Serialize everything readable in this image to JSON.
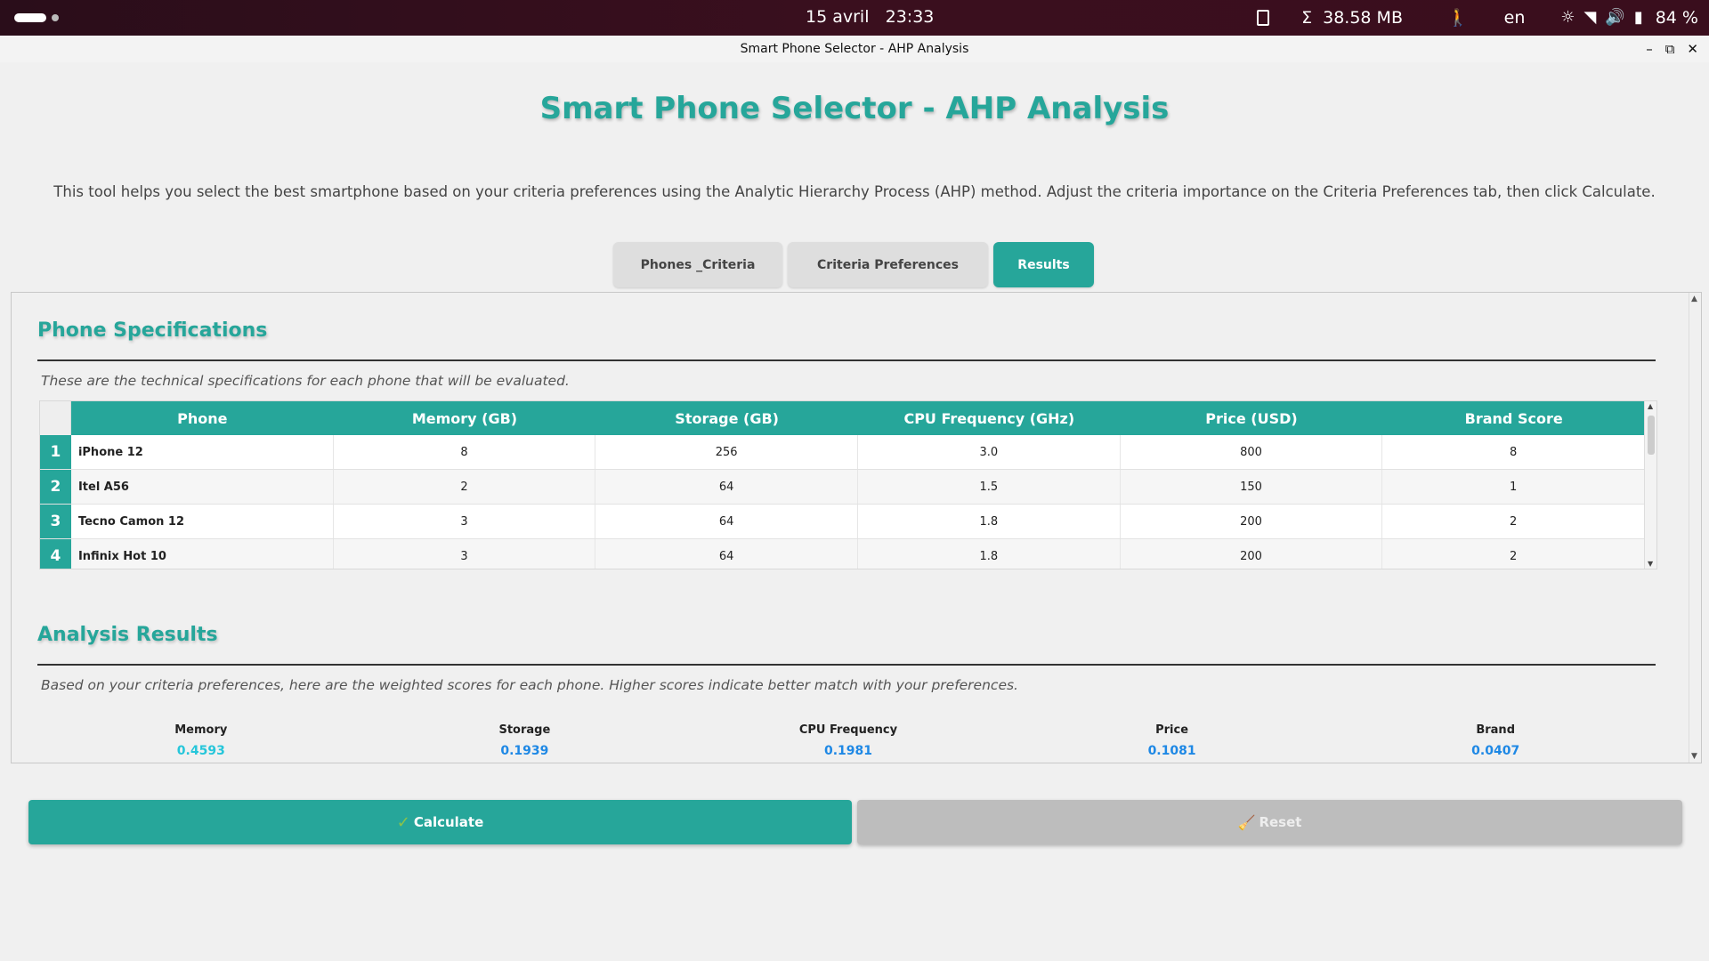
{
  "system_bar": {
    "date": "15 avril",
    "time": "23:33",
    "memory": "38.58 MB",
    "sigma": "Σ",
    "language": "en",
    "battery": "84 %"
  },
  "window": {
    "title": "Smart Phone Selector - AHP Analysis",
    "minimize": "–",
    "maximize": "⧉",
    "close": "✕"
  },
  "header": {
    "title": "Smart Phone Selector - AHP Analysis",
    "intro": "This tool helps you select the best smartphone based on your criteria preferences using the Analytic Hierarchy Process (AHP) method. Adjust the criteria importance on the Criteria Preferences tab, then click Calculate."
  },
  "tabs": [
    {
      "label": "Phones _Criteria",
      "active": false
    },
    {
      "label": "Criteria Preferences",
      "active": false
    },
    {
      "label": "Results",
      "active": true
    }
  ],
  "specs": {
    "title": "Phone Specifications",
    "note": "These are the technical specifications for each phone that will be evaluated.",
    "columns": [
      "Phone",
      "Memory (GB)",
      "Storage (GB)",
      "CPU Frequency (GHz)",
      "Price (USD)",
      "Brand Score"
    ],
    "rows": [
      {
        "num": "1",
        "cells": [
          "iPhone 12",
          "8",
          "256",
          "3.0",
          "800",
          "8"
        ]
      },
      {
        "num": "2",
        "cells": [
          "Itel A56",
          "2",
          "64",
          "1.5",
          "150",
          "1"
        ]
      },
      {
        "num": "3",
        "cells": [
          "Tecno Camon 12",
          "3",
          "64",
          "1.8",
          "200",
          "2"
        ]
      },
      {
        "num": "4",
        "cells": [
          "Infinix Hot 10",
          "3",
          "64",
          "1.8",
          "200",
          "2"
        ]
      }
    ]
  },
  "analysis": {
    "title": "Analysis Results",
    "note": "Based on your criteria preferences, here are the weighted scores for each phone. Higher scores indicate better match with your preferences.",
    "weights": [
      {
        "label": "Memory",
        "value": "0.4593"
      },
      {
        "label": "Storage",
        "value": "0.1939"
      },
      {
        "label": "CPU Frequency",
        "value": "0.1981"
      },
      {
        "label": "Price",
        "value": "0.1081"
      },
      {
        "label": "Brand",
        "value": "0.0407"
      }
    ]
  },
  "buttons": {
    "calculate_icon": "✓",
    "calculate": "Calculate",
    "reset_icon": "🧹",
    "reset": "Reset"
  },
  "colors": {
    "accent": "#26a69a",
    "secondary_button": "#bdbdbd"
  }
}
